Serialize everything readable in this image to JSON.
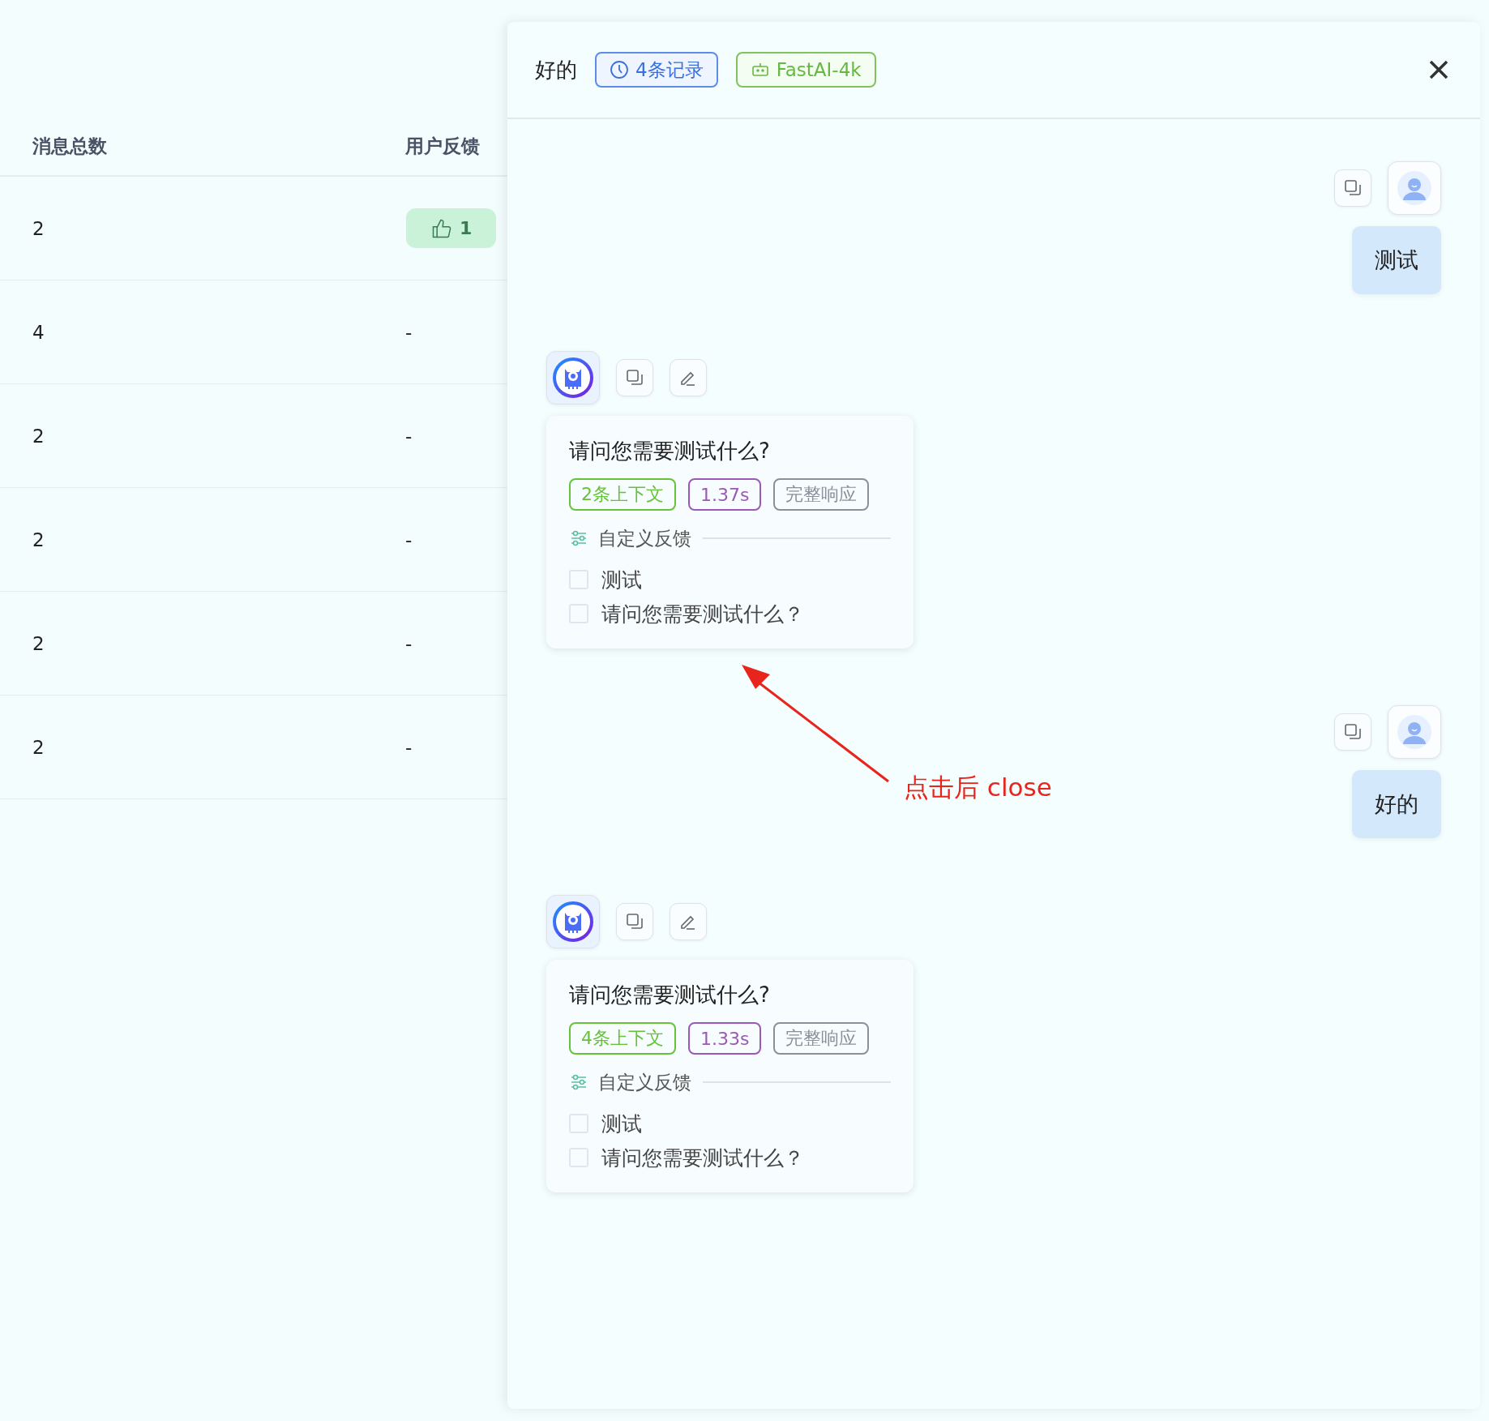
{
  "table": {
    "columns": [
      "消息总数",
      "用户反馈"
    ],
    "rows": [
      {
        "total": "2",
        "feedback": {
          "kind": "like",
          "text": "1"
        }
      },
      {
        "total": "4",
        "feedback": {
          "kind": "none",
          "text": "-"
        }
      },
      {
        "total": "2",
        "feedback": {
          "kind": "none",
          "text": "-"
        }
      },
      {
        "total": "2",
        "feedback": {
          "kind": "none",
          "text": "-"
        }
      },
      {
        "total": "2",
        "feedback": {
          "kind": "none",
          "text": "-"
        }
      },
      {
        "total": "2",
        "feedback": {
          "kind": "none",
          "text": "-"
        }
      }
    ]
  },
  "drawer": {
    "title": "好的",
    "records_tag": "4条记录",
    "model_tag": "FastAI-4k",
    "messages": [
      {
        "kind": "user",
        "text": "测试"
      },
      {
        "kind": "ai",
        "text": "请问您需要测试什么?",
        "tags": [
          {
            "text": "2条上下文",
            "color": "#67c23a"
          },
          {
            "text": "1.37s",
            "color": "#9b59b6"
          },
          {
            "text": "完整响应",
            "color": "#8a9099"
          }
        ],
        "feedback_label": "自定义反馈",
        "options": [
          {
            "text": "测试",
            "checked": false
          },
          {
            "text": "请问您需要测试什么？",
            "checked": false
          }
        ]
      },
      {
        "kind": "user",
        "text": "好的"
      },
      {
        "kind": "ai",
        "text": "请问您需要测试什么?",
        "tags": [
          {
            "text": "4条上下文",
            "color": "#67c23a"
          },
          {
            "text": "1.33s",
            "color": "#9b59b6"
          },
          {
            "text": "完整响应",
            "color": "#8a9099"
          }
        ],
        "feedback_label": "自定义反馈",
        "options": [
          {
            "text": "测试",
            "checked": false
          },
          {
            "text": "请问您需要测试什么？",
            "checked": false
          }
        ]
      }
    ]
  },
  "annotation": {
    "text": "点击后 close"
  }
}
